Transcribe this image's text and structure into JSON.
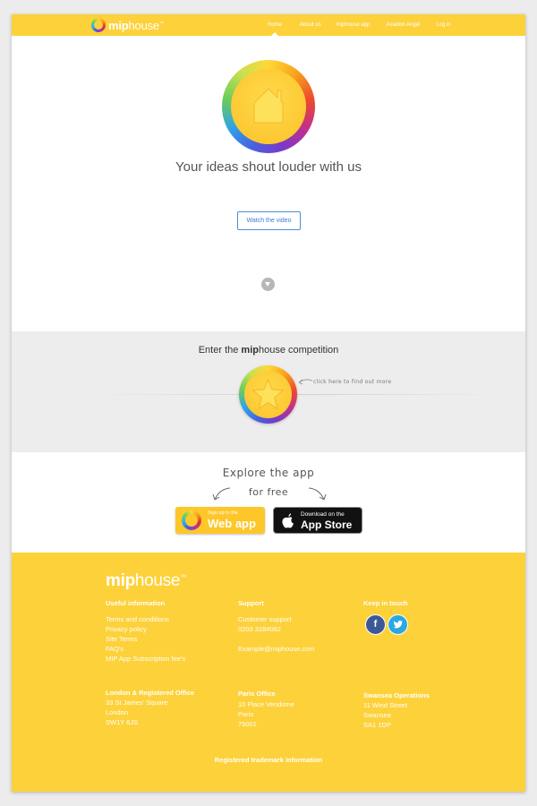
{
  "brand": {
    "logo_bold": "mip",
    "logo_light": "house",
    "tm": "™"
  },
  "nav": {
    "items": [
      {
        "label": "Home",
        "active": true
      },
      {
        "label": "About us",
        "active": false
      },
      {
        "label": "miphouse app",
        "active": false
      },
      {
        "label": "Aviation Angel",
        "active": false
      },
      {
        "label": "Log in",
        "active": false
      }
    ]
  },
  "hero": {
    "icon": "house-icon",
    "title": "Your ideas shout louder with us",
    "video_button": "Watch the video",
    "scroll_icon": "chevron-down-icon"
  },
  "competition": {
    "title_prefix": "Enter the ",
    "title_bold": "mip",
    "title_light": "house",
    "title_suffix": " competition",
    "icon": "star-icon",
    "hint": "click here to find out more"
  },
  "explore": {
    "line1": "Explore the app",
    "line2": "for free",
    "web_small": "Sign up to the",
    "web_big": "Web app",
    "store_small": "Download on the",
    "store_big": "App Store"
  },
  "footer": {
    "logo_bold": "mip",
    "logo_light": "house",
    "tm": "™",
    "useful": {
      "heading": "Useful information",
      "links": [
        "Terms and conditions",
        "Privacy policy",
        "Site Terms",
        "FAQ's",
        "MIP App Subscription fee's"
      ]
    },
    "support": {
      "heading": "Support",
      "link": "Customer support",
      "phone": "0203 3184062",
      "email": "Example@miphouse.com"
    },
    "keep": {
      "heading": "Keep in touch",
      "facebook": "f",
      "twitter": "t"
    },
    "london": {
      "heading": "London & Registered Office",
      "lines": [
        "33 St James' Square",
        "London",
        "SW1Y 6JS"
      ]
    },
    "paris": {
      "heading": "Paris Office",
      "lines": [
        "10 Place Vendome",
        "Paris",
        "75001"
      ]
    },
    "swansea": {
      "heading": "Swansea Operations",
      "lines": [
        "11 Wind Street",
        "Swansea",
        "SA1 1DP"
      ]
    },
    "trademark": "Registered trademark information"
  },
  "colors": {
    "brand_yellow": "#fdd13a",
    "button_blue": "#3a7fcf",
    "facebook": "#3b5998",
    "twitter": "#2aa9e0"
  }
}
